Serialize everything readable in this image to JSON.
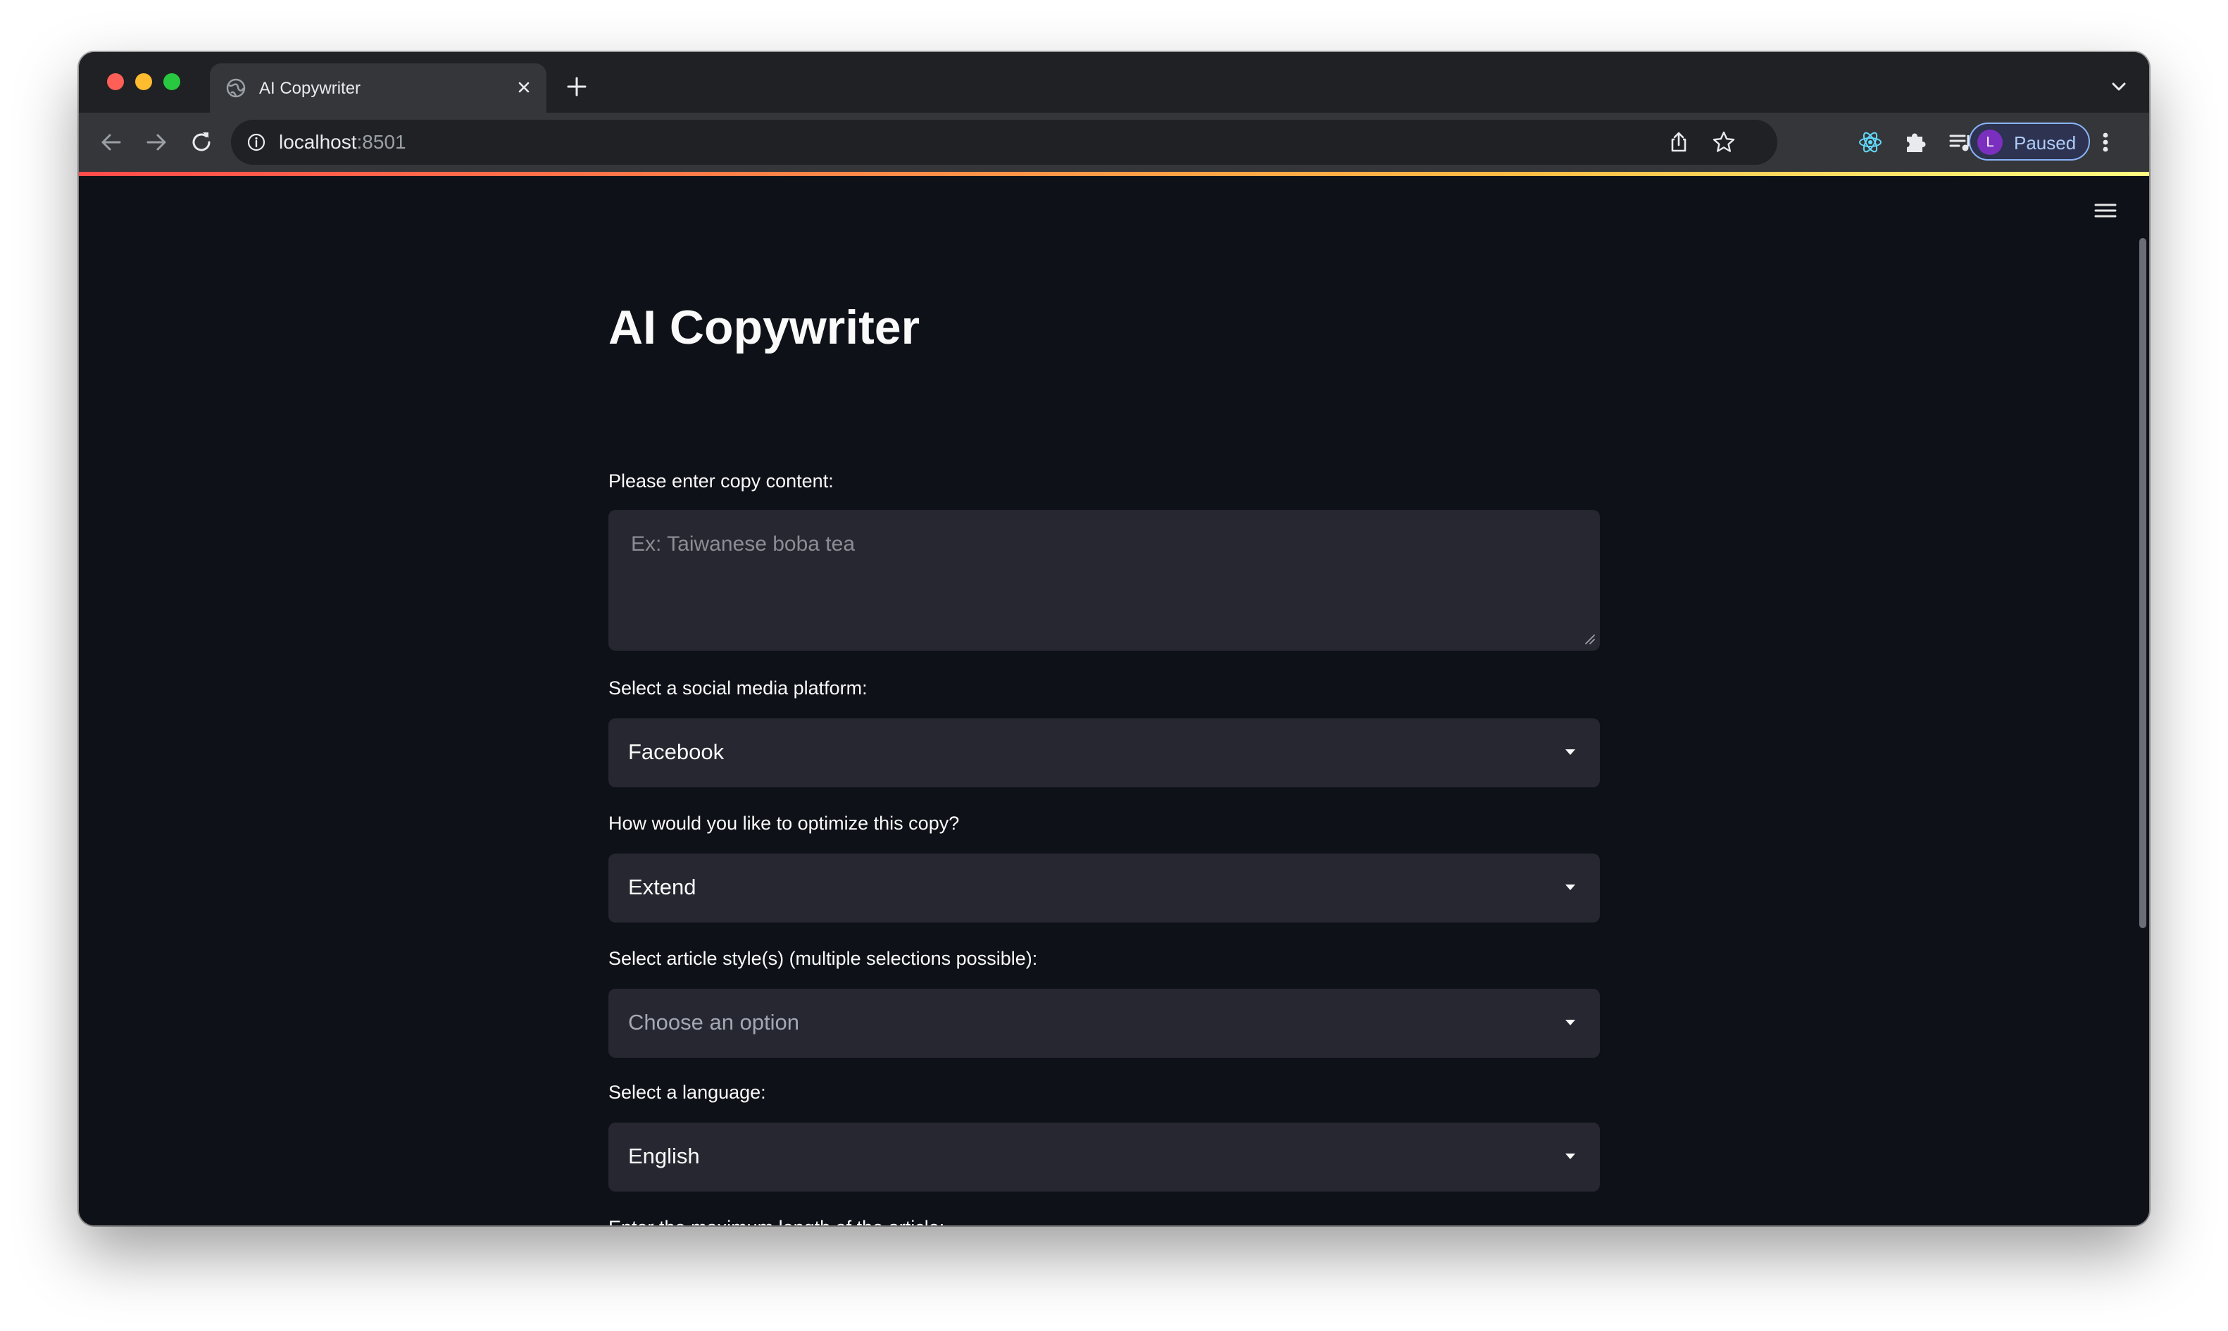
{
  "browser": {
    "tab_title": "AI Copywriter",
    "url_host": "localhost",
    "url_port": ":8501",
    "profile_initial": "L",
    "profile_status": "Paused"
  },
  "app": {
    "title": "AI Copywriter",
    "copy_content": {
      "label": "Please enter copy content:",
      "placeholder": "Ex: Taiwanese boba tea",
      "value": ""
    },
    "platform": {
      "label": "Select a social media platform:",
      "selected": "Facebook"
    },
    "optimize": {
      "label": "How would you like to optimize this copy?",
      "selected": "Extend"
    },
    "styles": {
      "label": "Select article style(s) (multiple selections possible):",
      "placeholder": "Choose an option"
    },
    "language": {
      "label": "Select a language:",
      "selected": "English"
    },
    "max_length": {
      "label": "Enter the maximum length of the article:"
    }
  },
  "colors": {
    "background": "#0e1117",
    "widget_background": "#262730",
    "text": "#fafafa",
    "accent_gradient": [
      "#ff4b4b",
      "#ffbd45",
      "#fffd80"
    ]
  },
  "icons": [
    "globe-icon",
    "close-icon",
    "plus-icon",
    "chevron-down-icon",
    "back-arrow-icon",
    "forward-arrow-icon",
    "reload-icon",
    "info-icon",
    "share-icon",
    "star-icon",
    "react-devtools-icon",
    "puzzle-icon",
    "reading-list-icon",
    "side-panel-icon",
    "kebab-menu-icon",
    "hamburger-menu-icon",
    "caret-down-icon"
  ]
}
